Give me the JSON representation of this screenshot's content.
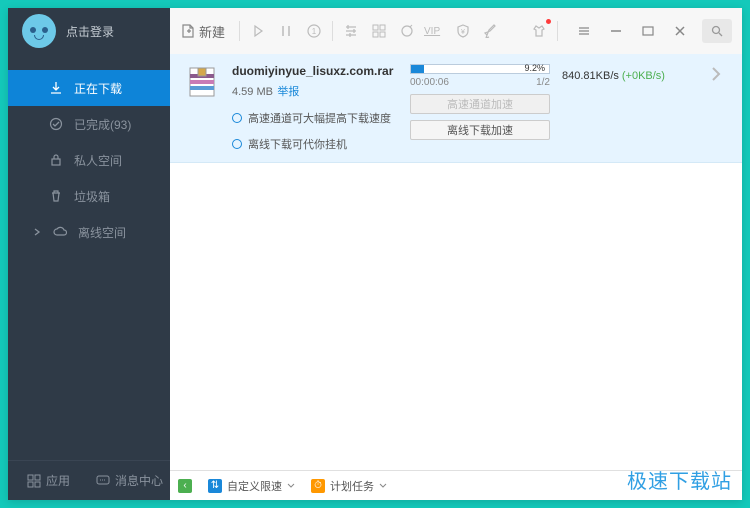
{
  "header": {
    "login_text": "点击登录",
    "new_button": "新建"
  },
  "sidebar": {
    "items": [
      {
        "label": "正在下载",
        "icon": "download"
      },
      {
        "label": "已完成(93)",
        "icon": "check"
      },
      {
        "label": "私人空间",
        "icon": "lock"
      },
      {
        "label": "垃圾箱",
        "icon": "trash"
      },
      {
        "label": "离线空间",
        "icon": "cloud"
      }
    ],
    "bottom": {
      "apps": "应用",
      "messages": "消息中心"
    }
  },
  "download": {
    "file_name": "duomiyinyue_lisuxz.com.rar",
    "file_size": "4.59 MB",
    "report": "举报",
    "tip1": "高速通道可大幅提高下载速度",
    "tip2": "离线下载可代你挂机",
    "progress_pct": "9.2%",
    "elapsed": "00:00:06",
    "parts": "1/2",
    "btn_highspeed": "高速通道加速",
    "btn_offline": "离线下载加速",
    "speed": "840.81KB/s",
    "speed_plus": "(+0KB/s)"
  },
  "bottom_bar": {
    "custom_speed": "自定义限速",
    "schedule": "计划任务"
  },
  "watermark": "极速下载站"
}
